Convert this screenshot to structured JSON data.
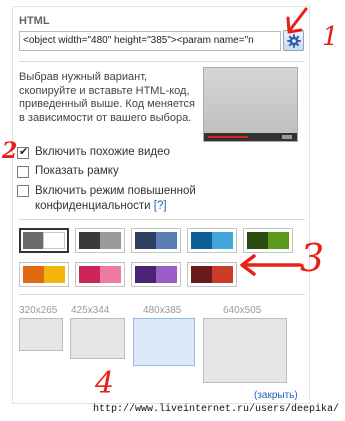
{
  "heading": "HTML",
  "embed_code": "<object width=\"480\" height=\"385\"><param name=\"n",
  "description": "Выбрав нужный вариант, скопируйте и вставьте HTML-код, приведенный выше. Код меняется в зависимости от вашего выбора.",
  "options": [
    {
      "label": "Включить похожие видео",
      "checked": true
    },
    {
      "label": "Показать рамку",
      "checked": false
    },
    {
      "label": "Включить режим повышенной конфиденциальности",
      "checked": false,
      "help": "[?]"
    }
  ],
  "color_schemes": [
    {
      "left": "#6b6b6b",
      "right": "#ffffff",
      "selected": true
    },
    {
      "left": "#3a3a3a",
      "right": "#9a9a9a",
      "selected": false
    },
    {
      "left": "#2d3f5e",
      "right": "#5b7fb5",
      "selected": false
    },
    {
      "left": "#0d5f96",
      "right": "#42a7db",
      "selected": false
    },
    {
      "left": "#2c4d12",
      "right": "#5b9a1a",
      "selected": false
    },
    {
      "left": "#e06a12",
      "right": "#f3b50b",
      "selected": false
    },
    {
      "left": "#cc2557",
      "right": "#ef79a5",
      "selected": false
    },
    {
      "left": "#4a2472",
      "right": "#9a5ec9",
      "selected": false
    },
    {
      "left": "#6a1a1a",
      "right": "#cc3a2a",
      "selected": false
    }
  ],
  "sizes": [
    {
      "label": "320x265",
      "selected": false
    },
    {
      "label": "425x344",
      "selected": false
    },
    {
      "label": "480x385",
      "selected": true
    },
    {
      "label": "640x505",
      "selected": false
    }
  ],
  "close_link": "(закрыть)",
  "footer_url": "http://www.liveinternet.ru/users/deepika/",
  "annotations": [
    "1",
    "2",
    "3",
    "4"
  ],
  "annotation_color": "#e8201a"
}
